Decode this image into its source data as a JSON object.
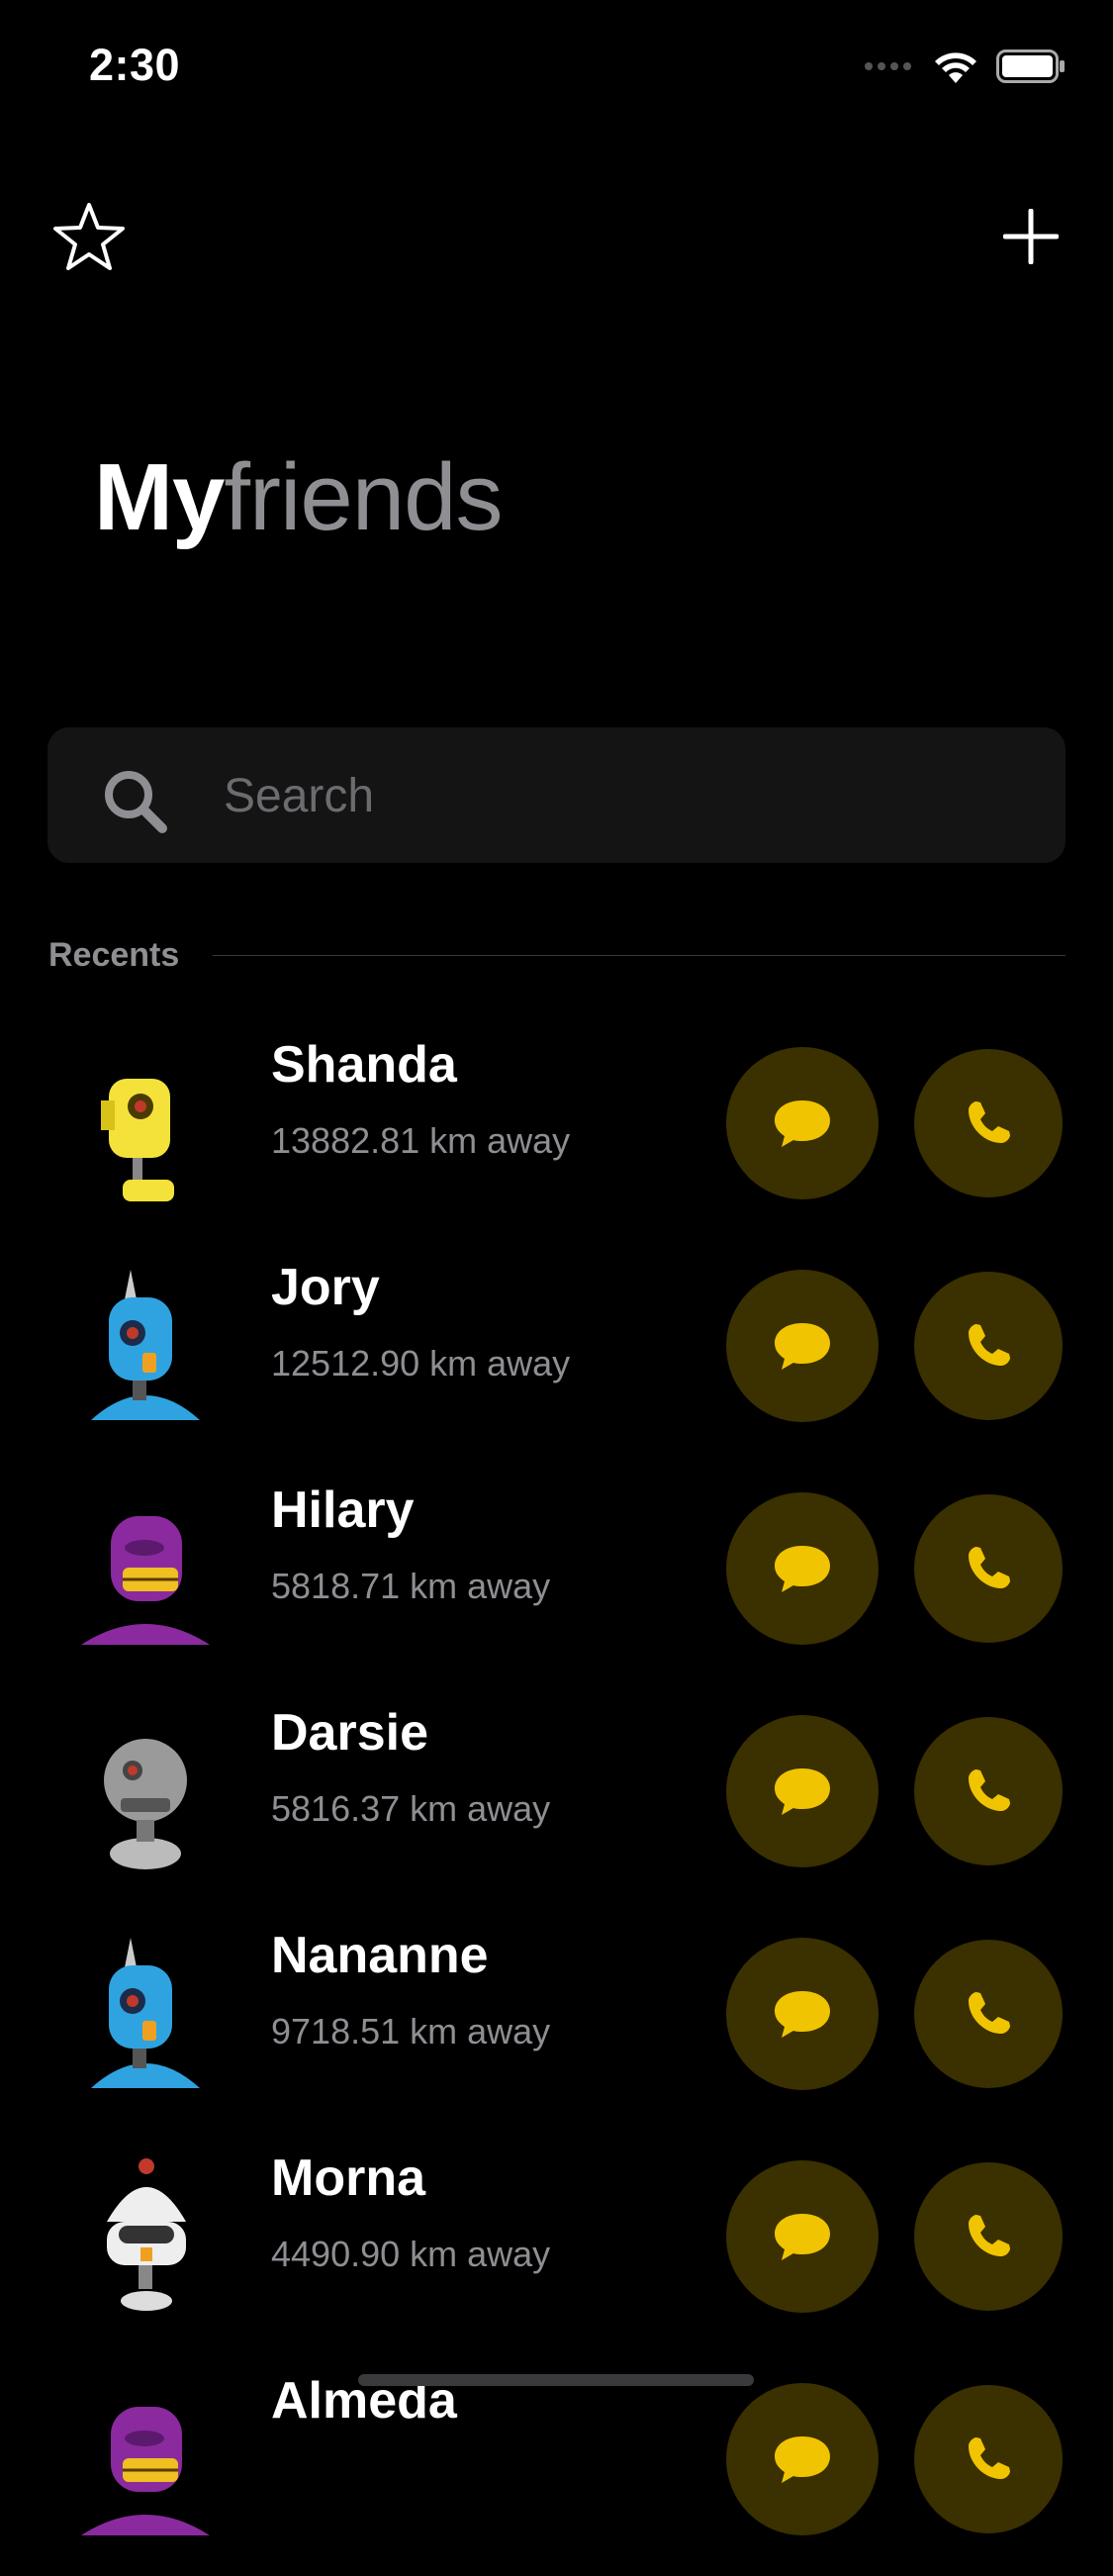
{
  "status_bar": {
    "time": "2:30"
  },
  "title": {
    "bold": "My",
    "light": "friends"
  },
  "search": {
    "placeholder": "Search"
  },
  "section": {
    "label": "Recents"
  },
  "colors": {
    "accent": "#f0c400",
    "circle_bg": "#3a3000",
    "secondary_text": "#8e8e93"
  },
  "contacts": [
    {
      "name": "Shanda",
      "distance": "13882.81 km away",
      "avatar": "yellow-robot"
    },
    {
      "name": "Jory",
      "distance": "12512.90 km away",
      "avatar": "blue-robot"
    },
    {
      "name": "Hilary",
      "distance": "5818.71 km away",
      "avatar": "purple-robot"
    },
    {
      "name": "Darsie",
      "distance": "5816.37 km away",
      "avatar": "gray-robot"
    },
    {
      "name": "Nananne",
      "distance": "9718.51 km away",
      "avatar": "blue-robot"
    },
    {
      "name": "Morna",
      "distance": "4490.90 km away",
      "avatar": "white-robot"
    },
    {
      "name": "Almeda",
      "distance": "",
      "avatar": "purple-robot"
    }
  ]
}
